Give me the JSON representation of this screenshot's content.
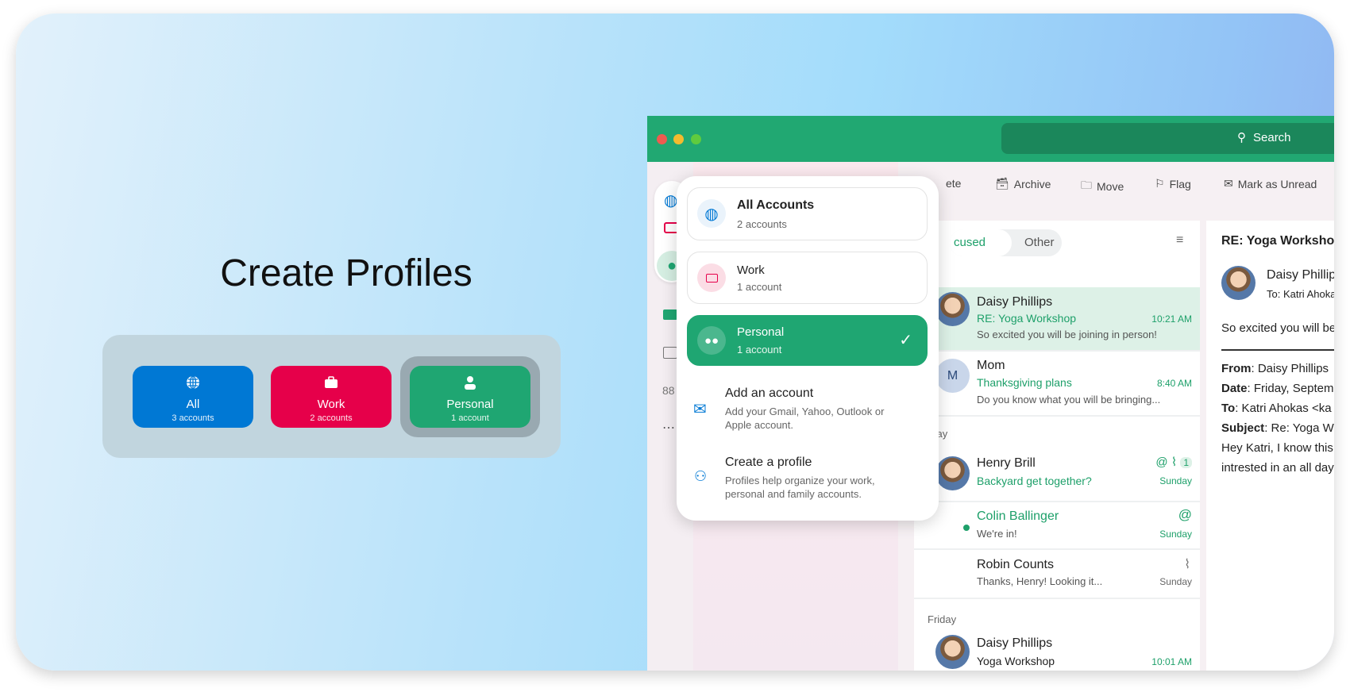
{
  "colors": {
    "all": "#0078d4",
    "work": "#e6004a",
    "personal": "#1fa672",
    "header": "#21a872"
  },
  "hero": {
    "title": "Create Profiles",
    "profiles": [
      {
        "label": "All",
        "sub": "3 accounts",
        "icon": "globe-icon"
      },
      {
        "label": "Work",
        "sub": "2 accounts",
        "icon": "briefcase-icon"
      },
      {
        "label": "Personal",
        "sub": "1 account",
        "icon": "person-icon",
        "selected": true
      }
    ]
  },
  "app": {
    "search": "Search",
    "toolbar": [
      "ete",
      "Archive",
      "Move",
      "Flag",
      "Mark as Unread"
    ],
    "tabs": [
      "cused",
      "Other"
    ],
    "popup": {
      "accounts": [
        {
          "title": "All Accounts",
          "sub": "2 accounts"
        },
        {
          "title": "Work",
          "sub": "1 account"
        },
        {
          "title": "Personal",
          "sub": "1 account",
          "selected": true
        }
      ],
      "add": {
        "title": "Add an account",
        "desc": "Add your Gmail, Yahoo, Outlook or Apple account."
      },
      "create": {
        "title": "Create a profile",
        "desc": "Profiles help organize your work, personal and family accounts."
      }
    },
    "groups": [
      "rday",
      "Friday"
    ],
    "messages": [
      {
        "name": "Daisy Phillips",
        "subject": "RE: Yoga Workshop",
        "preview": "So excited you will be joining in person!",
        "time": "10:21 AM"
      },
      {
        "name": "Mom",
        "subject": "Thanksgiving plans",
        "preview": "Do you know what you will be bringing...",
        "time": "8:40 AM",
        "initial": "M"
      },
      {
        "name": "Henry Brill",
        "subject": "Backyard get together?",
        "time": "Sunday",
        "count": "1"
      },
      {
        "name": "Colin Ballinger",
        "preview": "We're in!",
        "time": "Sunday"
      },
      {
        "name": "Robin Counts",
        "preview": "Thanks, Henry! Looking it...",
        "time": "Sunday"
      },
      {
        "name": "Daisy Phillips",
        "preview": "Yoga Workshop",
        "time": "10:01 AM"
      }
    ],
    "reading": {
      "title": "RE: Yoga Workshop",
      "sender": "Daisy Phillips",
      "to_label": "To:",
      "to": "Katri Ahokas",
      "snippet": "So excited you will be",
      "fields": [
        {
          "k": "From",
          "v": " Daisy Phillips"
        },
        {
          "k": "Date",
          "v": " Friday, Septem"
        },
        {
          "k": "To",
          "v": " Katri Ahokas <ka"
        },
        {
          "k": "Subject",
          "v": " Re: Yoga W"
        }
      ],
      "body1": "Hey Katri, I know this",
      "body2": "intrested in an all day"
    }
  }
}
